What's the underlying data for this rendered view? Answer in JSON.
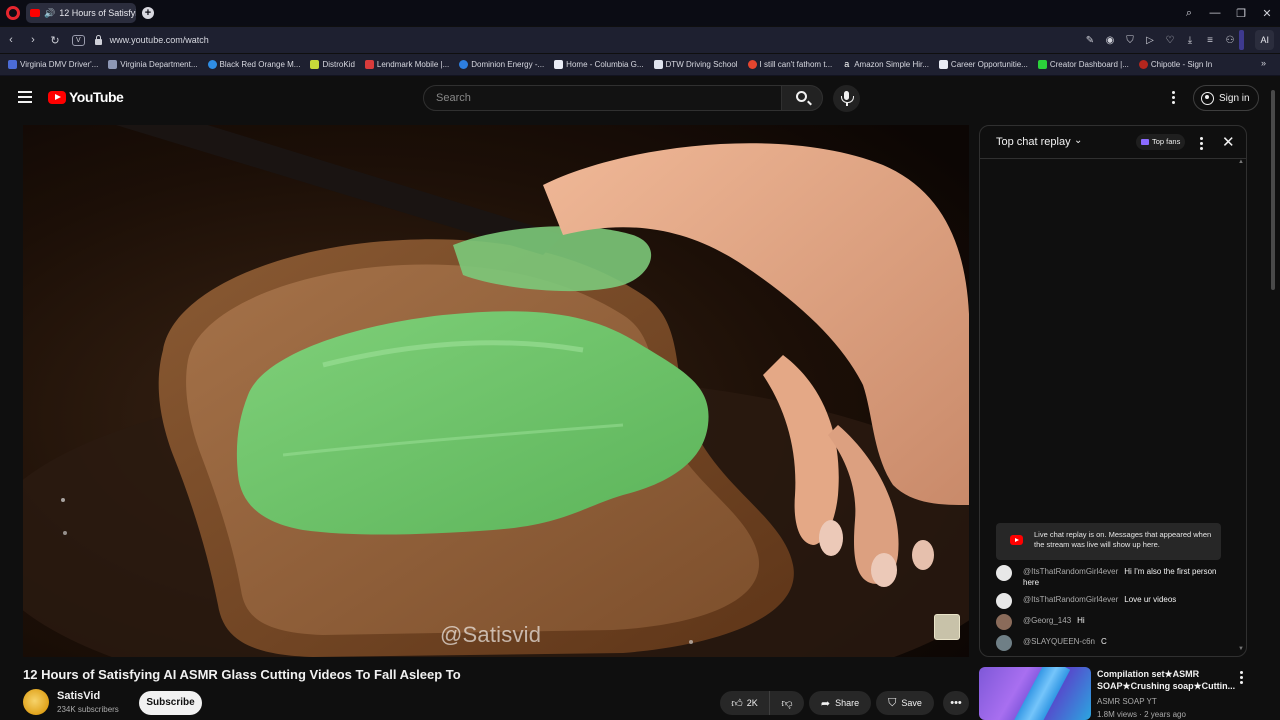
{
  "browser": {
    "tab_title": "12 Hours of Satisfying",
    "url": "www.youtube.com/watch",
    "ai_label": "AI",
    "bookmarks": [
      "Virginia DMV Driver'...",
      "Virginia Department...",
      "Black Red Orange M...",
      "DistroKid",
      "Lendmark Mobile |...",
      "Dominion Energy -...",
      "Home - Columbia G...",
      "DTW Driving School",
      "I still can't fathom t...",
      "Amazon Simple Hir...",
      "Career Opportunitie...",
      "Creator Dashboard |...",
      "Chipotle - Sign In"
    ]
  },
  "header": {
    "logo_text": "YouTube",
    "search_placeholder": "Search",
    "signin_label": "Sign in"
  },
  "video": {
    "watermark": "@Satisvid",
    "title": "12 Hours of Satisfying AI ASMR Glass Cutting Videos To Fall Asleep To",
    "channel_name": "SatisVid",
    "subscribers": "234K subscribers",
    "subscribe_label": "Subscribe",
    "likes": "2K",
    "share_label": "Share",
    "save_label": "Save"
  },
  "chat": {
    "title": "Top chat replay",
    "top_fans_label": "Top fans",
    "notice": "Live chat replay is on. Messages that appeared when the stream was live will show up here.",
    "messages": [
      {
        "author": "@ItsThatRandomGirl4ever",
        "text": "Hi I'm also the first person here"
      },
      {
        "author": "@ItsThatRandomGirl4ever",
        "text": "Love ur videos"
      },
      {
        "author": "@Georg_143",
        "text": "Hi"
      },
      {
        "author": "@SLAYQUEEN-c6n",
        "text": "C"
      }
    ]
  },
  "recommendation": {
    "title": "Compilation set★ASMR SOAP★Crushing soap★Cuttin...",
    "channel": "ASMR SOAP YT",
    "meta": "1.8M views · 2 years ago"
  },
  "colors": {
    "background": "#0f0f0f",
    "youtube_red": "#ff0000",
    "opera_red": "#e5262e",
    "spread_green": "#6fc46a"
  }
}
